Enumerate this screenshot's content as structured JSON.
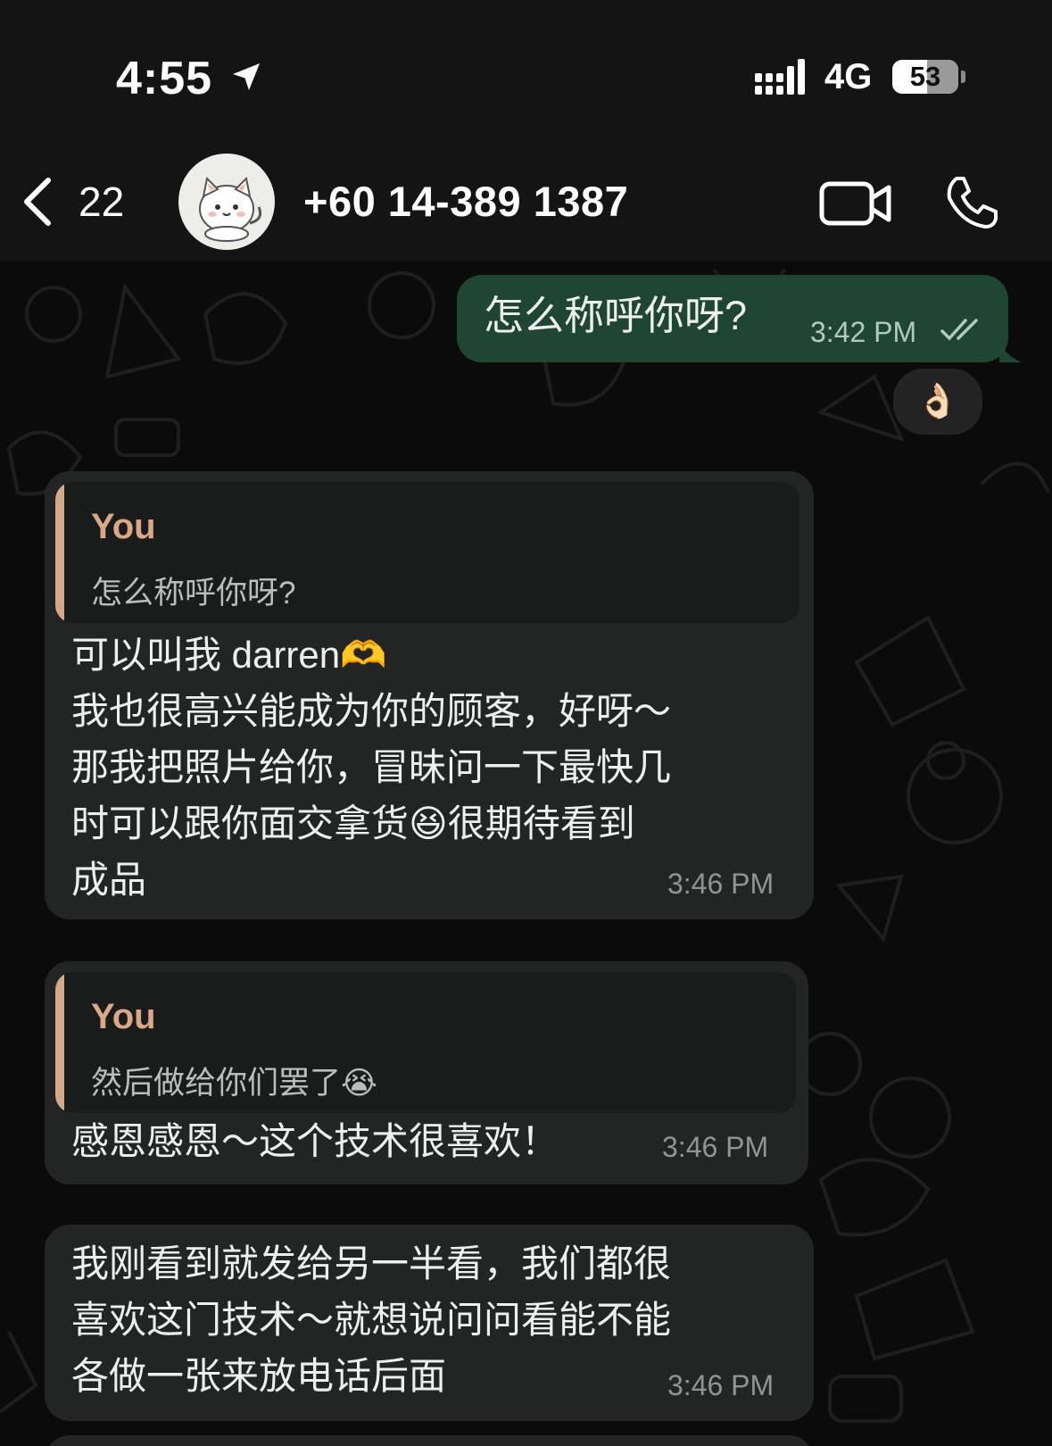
{
  "status_bar": {
    "time": "4:55",
    "network": "4G",
    "battery": "53",
    "battery_level_percent": 53
  },
  "header": {
    "back_count": "22",
    "contact_name": "+60 14-389 1387"
  },
  "messages": [
    {
      "direction": "outgoing",
      "text": "怎么称呼你呀?",
      "time": "3:42 PM",
      "status": "read",
      "reaction": "👌🏻"
    },
    {
      "direction": "incoming",
      "reply_to": {
        "author": "You",
        "text": "怎么称呼你呀?"
      },
      "text": "可以叫我 darren🫶\n我也很高兴能成为你的顾客，好呀～\n那我把照片给你，冒昧问一下最快几\n时可以跟你面交拿货😆很期待看到\n成品",
      "time": "3:46 PM"
    },
    {
      "direction": "incoming",
      "reply_to": {
        "author": "You",
        "text": "然后做给你们罢了😭"
      },
      "text": "感恩感恩～这个技术很喜欢！",
      "time": "3:46 PM"
    },
    {
      "direction": "incoming",
      "text": "我刚看到就发给另一半看，我们都很\n喜欢这门技术～就想说问问看能不能\n各做一张来放电话后面",
      "time": "3:46 PM"
    }
  ],
  "colors": {
    "outgoing_bubble": "#1f4533",
    "incoming_bubble": "#222524",
    "quote_accent": "#d4a98b"
  }
}
